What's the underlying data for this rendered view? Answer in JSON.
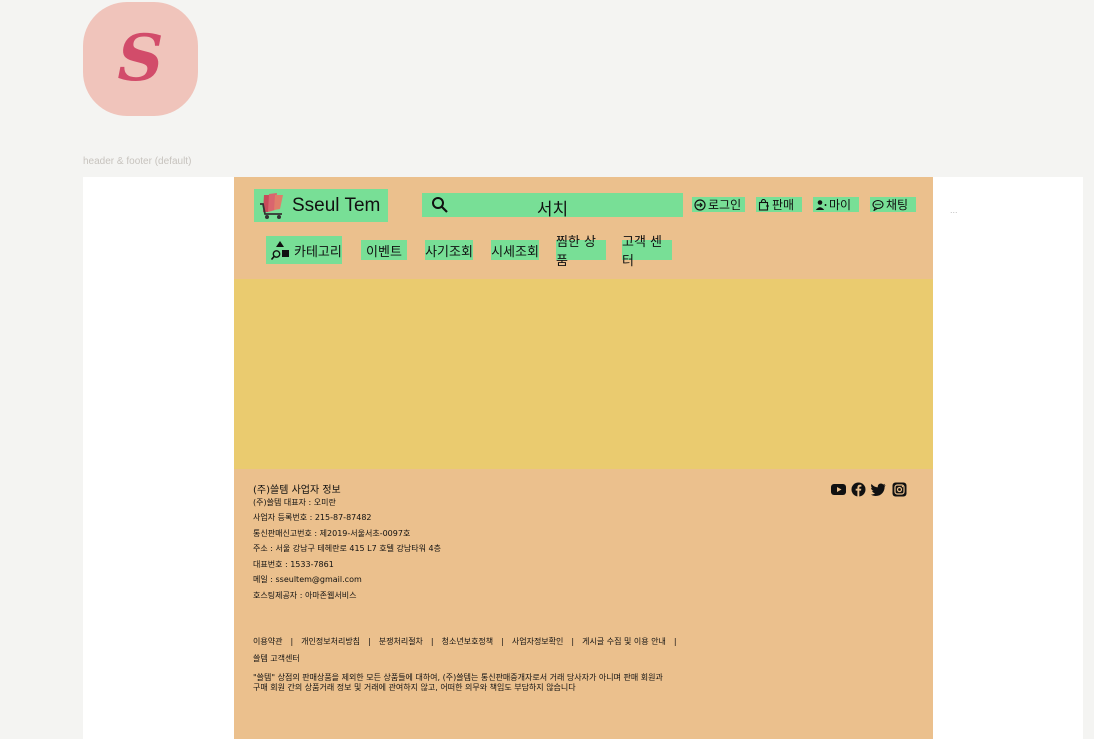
{
  "app_icon": {
    "letter": "S"
  },
  "frame_label": "header & footer (default)",
  "ellipsis": "...",
  "header": {
    "logo_text": "Sseul Tem",
    "search_text": "서치",
    "utils": {
      "login": "로그인",
      "sell": "판매",
      "my": "마이",
      "chat": "채팅"
    },
    "nav": {
      "category": "카테고리",
      "event": "이벤트",
      "buy": "사기조회",
      "price": "시세조회",
      "wishlist": "찜한 상품",
      "support": "고객 센터"
    }
  },
  "footer": {
    "company_title": "(주)쓸템 사업자 정보",
    "info": [
      "(주)쓸템 대표자 : 오미란",
      "사업자 등록번호 : 215-87-87482",
      "통신판매신고번호 : 제2019-서울서초-0097호",
      "주소 : 서울 강남구 테헤란로 415 L7 호텔 강남타워 4층",
      "대표번호 : 1533-7861",
      "메일 : sseultem@gmail.com",
      "호스팅제공자 : 아마존웹서비스"
    ],
    "links": [
      "이용약관",
      "개인정보처리방침",
      "분쟁처리절차",
      "청소년보호정책",
      "사업자정보확인",
      "게시글 수집 및 이용 안내"
    ],
    "separator": "|",
    "support_link": "쓸템 고객센터",
    "disclaimer_line1": "\"쓸템\" 상점의 판매상품을 제외한 모든 상품들에 대하여, (주)쓸템는 통신판매중개자로서 거래 당사자가 아니며 판매 회원과",
    "disclaimer_line2": "구매 회원 간의 상품거래 정보 및 거래에 관여하지 않고, 어떠한 의무와 책임도 부담하지 않습니다",
    "social_icons": [
      "youtube-icon",
      "facebook-icon",
      "twitter-icon",
      "instagram-icon"
    ]
  },
  "colors": {
    "background": "#f4f4f2",
    "page": "#ebc08d",
    "accent_green": "#78df96",
    "banner": "#eacb6f",
    "app_icon_bg": "#f0c4bb",
    "app_icon_letter": "#d24c6a"
  }
}
